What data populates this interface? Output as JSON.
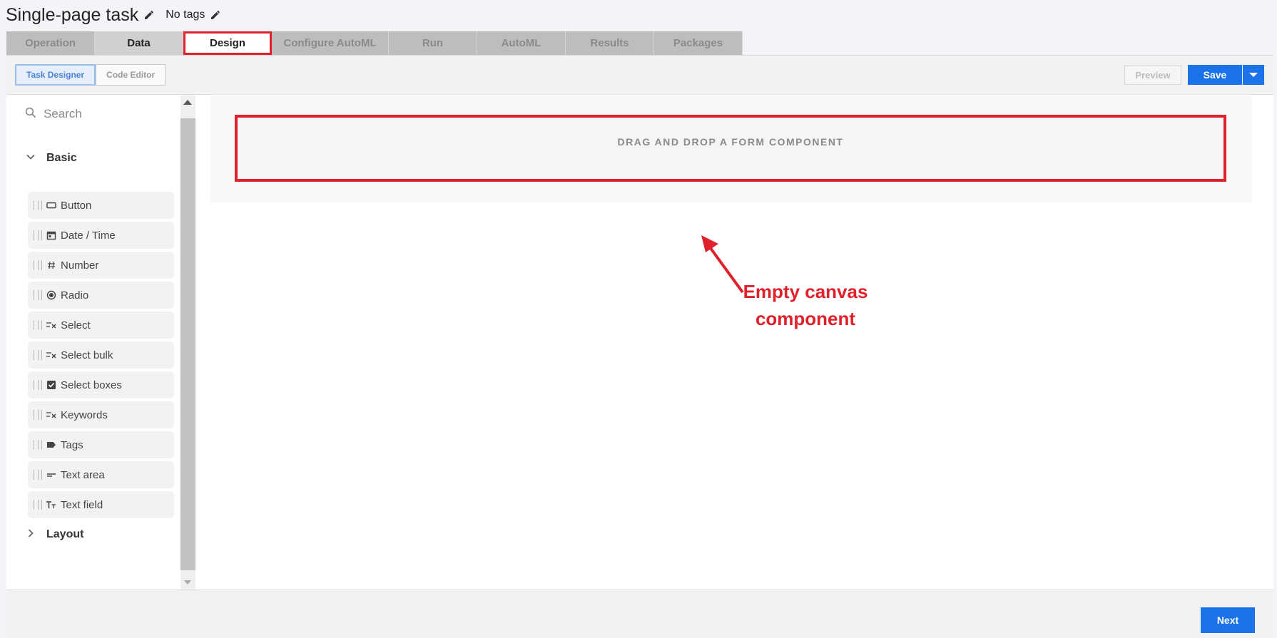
{
  "header": {
    "title": "Single-page task",
    "tags_label": "No tags"
  },
  "tabs": [
    {
      "label": "Operation",
      "state": "disabled"
    },
    {
      "label": "Data",
      "state": "visited"
    },
    {
      "label": "Design",
      "state": "active"
    },
    {
      "label": "Configure AutoML",
      "state": "disabled"
    },
    {
      "label": "Run",
      "state": "disabled"
    },
    {
      "label": "AutoML",
      "state": "disabled"
    },
    {
      "label": "Results",
      "state": "disabled"
    },
    {
      "label": "Packages",
      "state": "disabled"
    }
  ],
  "toolbar": {
    "task_designer_label": "Task Designer",
    "code_editor_label": "Code Editor",
    "preview_label": "Preview",
    "save_label": "Save"
  },
  "sidebar": {
    "search_placeholder": "Search",
    "groups": {
      "basic": "Basic",
      "layout": "Layout"
    },
    "components": [
      {
        "label": "Button",
        "icon": "button-icon"
      },
      {
        "label": "Date / Time",
        "icon": "calendar-icon"
      },
      {
        "label": "Number",
        "icon": "hash-icon"
      },
      {
        "label": "Radio",
        "icon": "radio-icon"
      },
      {
        "label": "Select",
        "icon": "select-list-icon"
      },
      {
        "label": "Select bulk",
        "icon": "select-list-icon"
      },
      {
        "label": "Select boxes",
        "icon": "checkbox-icon"
      },
      {
        "label": "Keywords",
        "icon": "select-list-icon"
      },
      {
        "label": "Tags",
        "icon": "tag-icon"
      },
      {
        "label": "Text area",
        "icon": "text-area-icon"
      },
      {
        "label": "Text field",
        "icon": "text-field-icon"
      }
    ]
  },
  "canvas": {
    "dropzone_label": "DRAG AND DROP A FORM COMPONENT",
    "annotation_line1": "Empty canvas",
    "annotation_line2": "component"
  },
  "footer": {
    "next_label": "Next"
  },
  "colors": {
    "accent": "#1a73e8",
    "highlight": "#e0202a"
  }
}
